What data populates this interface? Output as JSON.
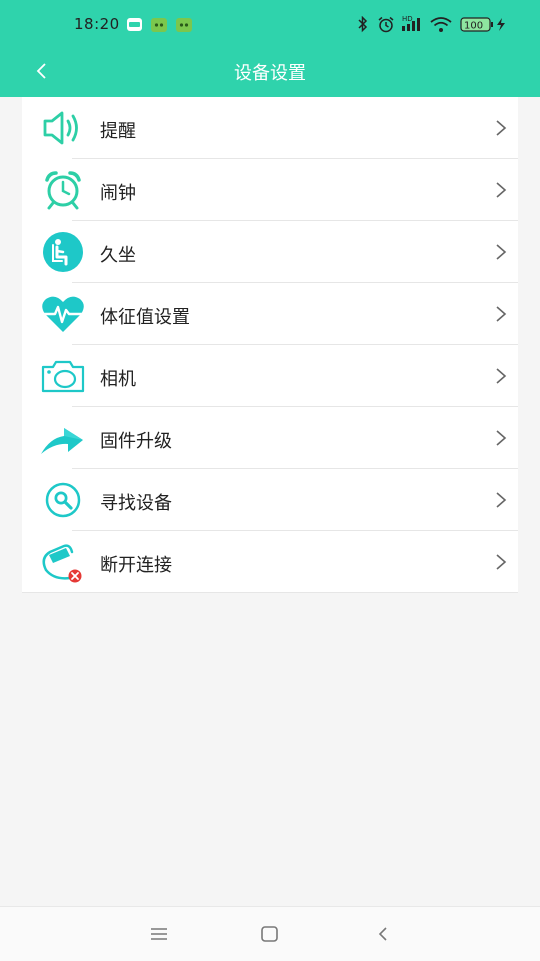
{
  "status_bar": {
    "time": "18:20",
    "battery": "100",
    "network": "HD"
  },
  "app_bar": {
    "title": "设备设置",
    "back_icon": "chevron-left-icon"
  },
  "settings": [
    {
      "label": "提醒",
      "icon": "speaker-icon"
    },
    {
      "label": "闹钟",
      "icon": "alarm-clock-icon"
    },
    {
      "label": "久坐",
      "icon": "sitting-person-icon"
    },
    {
      "label": "体征值设置",
      "icon": "heart-pulse-icon"
    },
    {
      "label": "相机",
      "icon": "camera-icon"
    },
    {
      "label": "固件升级",
      "icon": "upgrade-arrow-icon"
    },
    {
      "label": "寻找设备",
      "icon": "search-device-icon"
    },
    {
      "label": "断开连接",
      "icon": "disconnect-icon"
    }
  ],
  "colors": {
    "accent": "#2fd3ac",
    "icon": "#1ec8c8",
    "disconnect_badge": "#e53935"
  }
}
